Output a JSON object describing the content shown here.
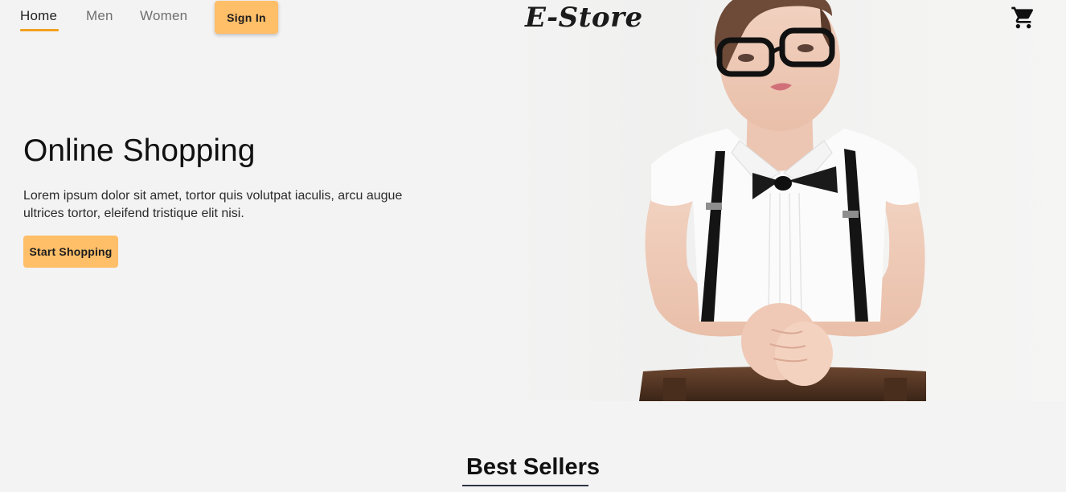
{
  "nav": {
    "links": [
      {
        "label": "Home",
        "active": true
      },
      {
        "label": "Men",
        "active": false
      },
      {
        "label": "Women",
        "active": false
      }
    ],
    "signin_label": "Sign In",
    "logo": "E-Store",
    "cart_icon": "shopping-cart-icon"
  },
  "hero": {
    "title": "Online Shopping",
    "description": "Lorem ipsum dolor sit amet, tortor quis volutpat iaculis, arcu augue ultrices tortor, eleifend tristique elit nisi.",
    "cta_label": "Start Shopping"
  },
  "best_sellers": {
    "title": "Best Sellers"
  },
  "colors": {
    "accent": "#ffbe68",
    "active_underline": "#f0a020",
    "background": "#f3f3f3",
    "section_underline": "#2e3344"
  }
}
